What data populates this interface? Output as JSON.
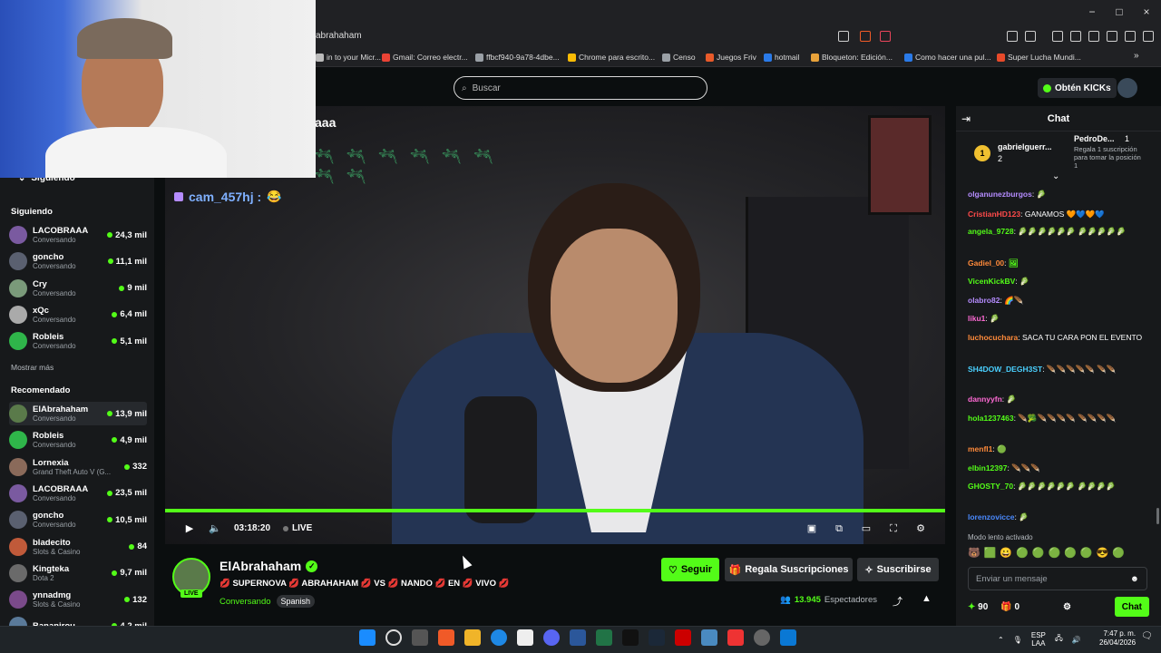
{
  "browser": {
    "url": "kick.com/elabrahaham",
    "url_visible": "abrahaham",
    "bookmarks": [
      {
        "label": "in to your Micr...",
        "color": "#bbbbbb"
      },
      {
        "label": "Gmail: Correo electr...",
        "color": "#ea4335"
      },
      {
        "label": "ffbcf940-9a78-4dbe...",
        "color": "#9aa0a6"
      },
      {
        "label": "Chrome para escrito...",
        "color": "#fbbc05"
      },
      {
        "label": "Censo",
        "color": "#9aa0a6"
      },
      {
        "label": "Juegos Friv",
        "color": "#e85a2a"
      },
      {
        "label": "hotmail",
        "color": "#2a7ae8"
      },
      {
        "label": "Bloqueton: Edición...",
        "color": "#e8a23a"
      },
      {
        "label": "Como hacer una pul...",
        "color": "#2a7ae8"
      },
      {
        "label": "Super Lucha Mundi...",
        "color": "#e84a2a"
      }
    ]
  },
  "header": {
    "search_placeholder": "Buscar",
    "kicks_label": "Obtén KICKs"
  },
  "sidebar": {
    "following_title": "Siguiendo",
    "following_section": "Siguiendo",
    "following": [
      {
        "name": "LACOBRAAA",
        "sub": "Conversando",
        "count": "24,3 mil"
      },
      {
        "name": "goncho",
        "sub": "Conversando",
        "count": "11,1 mil"
      },
      {
        "name": "Cry",
        "sub": "Conversando",
        "count": "9 mil"
      },
      {
        "name": "xQc",
        "sub": "Conversando",
        "count": "6,4 mil"
      },
      {
        "name": "Robleis",
        "sub": "Conversando",
        "count": "5,1 mil"
      }
    ],
    "show_more": "Mostrar más",
    "recommended_section": "Recomendado",
    "recommended": [
      {
        "name": "ElAbrahaham",
        "sub": "Conversando",
        "count": "13,9 mil"
      },
      {
        "name": "Robleis",
        "sub": "Conversando",
        "count": "4,9 mil"
      },
      {
        "name": "Lornexia",
        "sub": "Grand Theft Auto V (G...",
        "count": "332"
      },
      {
        "name": "LACOBRAAA",
        "sub": "Conversando",
        "count": "23,5 mil"
      },
      {
        "name": "goncho",
        "sub": "Conversando",
        "count": "10,5 mil"
      },
      {
        "name": "bladecito",
        "sub": "Slots & Casino",
        "count": "84"
      },
      {
        "name": "Kingteka",
        "sub": "Dota 2",
        "count": "9,7 mil"
      },
      {
        "name": "ynnadmg",
        "sub": "Slots & Casino",
        "count": "132"
      },
      {
        "name": "Bananirou",
        "sub": "",
        "count": "4,2 mil"
      }
    ]
  },
  "video": {
    "overlay_title": "aaa",
    "overlay_chat_user": "cam_457hj :",
    "time": "03:18:20",
    "live_label": "LIVE"
  },
  "stream": {
    "channel": "ElAbrahaham",
    "live_badge": "LIVE",
    "title": "💋 SUPERNOVA 💋 ABRAHAHAM 💋 VS 💋 NANDO 💋 EN 💋 VIVO 💋",
    "category": "Conversando",
    "language": "Spanish",
    "follow": "Seguir",
    "gift": "Regala Suscripciones",
    "subscribe": "Suscribirse",
    "viewers": "13.945",
    "viewers_label": "Espectadores"
  },
  "chat": {
    "title": "Chat",
    "pinned": {
      "user": "gabrielguerr...",
      "rank": "1",
      "value": "2",
      "right_user": "PedroDe...",
      "right_rank": "1",
      "right_text": "Regala 1 suscripción para tomar la posición 1"
    },
    "messages": [
      {
        "user": "olganunezburgos",
        "color": "#b58cff",
        "text": "",
        "emotes": "🥬"
      },
      {
        "user": "CristianHD123",
        "color": "#ff4a4a",
        "text": "GANAMOS",
        "emotes": "🧡💙🧡💙"
      },
      {
        "user": "angela_9728",
        "color": "#53fc18",
        "text": "",
        "emotes": "🥬🥬🥬🥬🥬🥬 🥬🥬🥬🥬🥬"
      },
      {
        "user": "Gadiel_00",
        "color": "#ff8a3a",
        "text": "",
        "emotes": "🖼"
      },
      {
        "user": "VicenKickBV",
        "color": "#53fc18",
        "text": "",
        "emotes": "🥬"
      },
      {
        "user": "olabro82",
        "color": "#b58cff",
        "text": "",
        "emotes": "🌈🪶"
      },
      {
        "user": "liku1",
        "color": "#ff6ad5",
        "text": "",
        "emotes": "🥬"
      },
      {
        "user": "luchocuchara",
        "color": "#ff8a3a",
        "text": "SACA TU CARA PON EL EVENTO",
        "emotes": ""
      },
      {
        "user": "SH4DOW_DEGH3ST",
        "color": "#4ad0ff",
        "text": "",
        "emotes": "🪶🪶🪶🪶🪶 🪶🪶"
      },
      {
        "user": "dannyyfn",
        "color": "#ff6ad5",
        "text": "",
        "emotes": "🥬"
      },
      {
        "user": "hola1237463",
        "color": "#53fc18",
        "text": "",
        "emotes": "🪶🥦🪶🪶🪶🪶 🪶🪶🪶🪶"
      },
      {
        "user": "menfl1",
        "color": "#ff8a3a",
        "text": "",
        "emotes": "🟢"
      },
      {
        "user": "elbin12397",
        "color": "#53fc18",
        "text": "",
        "emotes": "🪶🪶🪶"
      },
      {
        "user": "GHOSTY_70",
        "color": "#53fc18",
        "text": "",
        "emotes": "🥬🥬🥬🥬🥬🥬 🥬🥬🥬🥬"
      },
      {
        "user": "lorenzovicce",
        "color": "#4a8aff",
        "text": "",
        "emotes": "🥬"
      }
    ],
    "slow_mode": "Modo lento activado",
    "input_placeholder": "Enviar un mensaje",
    "points": "90",
    "gifts": "0",
    "send": "Chat"
  },
  "taskbar": {
    "lang": "ESP",
    "lang2": "LAA",
    "time": "7:47 p. m.",
    "date": "26/04/2026"
  },
  "colors": {
    "accent": "#53fc18",
    "bg": "#0b0e0f",
    "panel": "#17191b"
  }
}
